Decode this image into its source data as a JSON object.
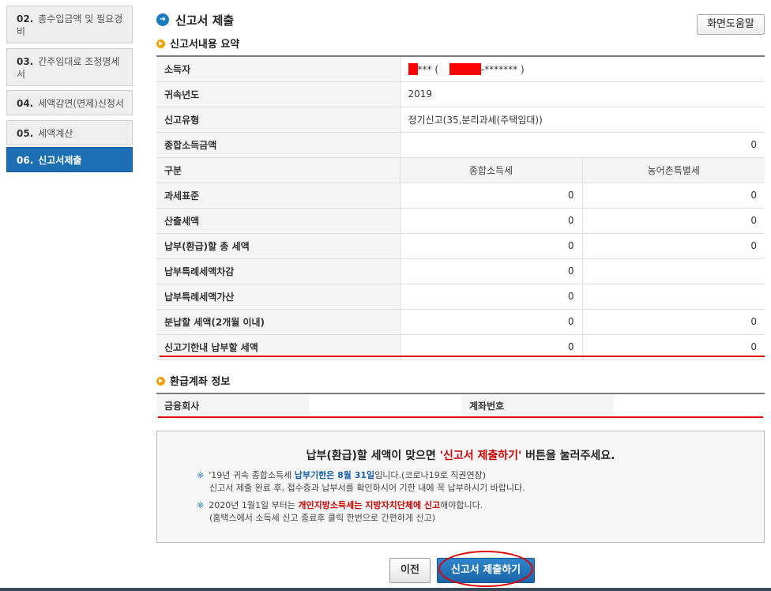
{
  "sidebar": {
    "steps": [
      {
        "num": "02.",
        "label": "총수입금액 및 필요경비"
      },
      {
        "num": "03.",
        "label": "간주임대료 조정명세서"
      },
      {
        "num": "04.",
        "label": "세액감면(면제)신청서"
      },
      {
        "num": "05.",
        "label": "세액계산"
      },
      {
        "num": "06.",
        "label": "신고서제출"
      }
    ]
  },
  "header": {
    "title": "신고서 제출",
    "help_button": "화면도움말"
  },
  "summary": {
    "section_title": "신고서내용 요약",
    "taxpayer_label": "소득자",
    "taxpayer_value_a": "***  (",
    "taxpayer_value_b": "-*******  )",
    "year_label": "귀속년도",
    "year_value": "2019",
    "type_label": "신고유형",
    "type_value": "정기신고(35,분리과세(주택임대))",
    "income_label": "종합소득금액",
    "income_value": "0",
    "col_label": "구분",
    "col_income_tax": "종합소득세",
    "col_rural_tax": "농어촌특별세",
    "rows": [
      {
        "label": "과세표준",
        "a": "0",
        "b": "0"
      },
      {
        "label": "산출세액",
        "a": "0",
        "b": "0"
      },
      {
        "label": "납부(환급)할 총 세액",
        "a": "0",
        "b": "0"
      },
      {
        "label": "납부특례세액차감",
        "a": "0",
        "b": ""
      },
      {
        "label": "납부특례세액가산",
        "a": "0",
        "b": ""
      },
      {
        "label": "분납할 세액(2개월 이내)",
        "a": "0",
        "b": "0"
      },
      {
        "label": "신고기한내 납부할 세액",
        "a": "0",
        "b": "0"
      }
    ]
  },
  "refund": {
    "section_title": "환급계좌 정보",
    "bank_label": "금융회사",
    "bank_value": "",
    "account_label": "계좌번호",
    "account_value": ""
  },
  "notice": {
    "main_pre": "납부(환급)할 세액이 맞으면 ",
    "main_red": "'신고서 제출하기'",
    "main_post": " 버튼을 눌러주세요.",
    "note1_star": "※",
    "note1_a": "'19년 귀속 종합소득세 ",
    "note1_b": "납부기한은",
    "note1_c": " 8월 31일",
    "note1_d": "입니다.(코로나19로 직권연장)",
    "note1_line2": "신고서 제출 완료 후, 접수증과 납부서를 확인하시어 기한 내에 꼭 납부하시기 바랍니다.",
    "note2_star": "※",
    "note2_a": "2020년 1월1일 부터는 ",
    "note2_b": "개인지방소득세는",
    "note2_c": " 지방자치단체에 신고",
    "note2_d": "해야합니다.",
    "note2_line2": "(홈택스에서 소득세 신고 종료후 클릭 한번으로 간편하게 신고)"
  },
  "buttons": {
    "prev": "이전",
    "submit": "신고서 제출하기"
  },
  "colors": {
    "accent": "#1d6fb4",
    "annotation_red": "#e00000"
  }
}
